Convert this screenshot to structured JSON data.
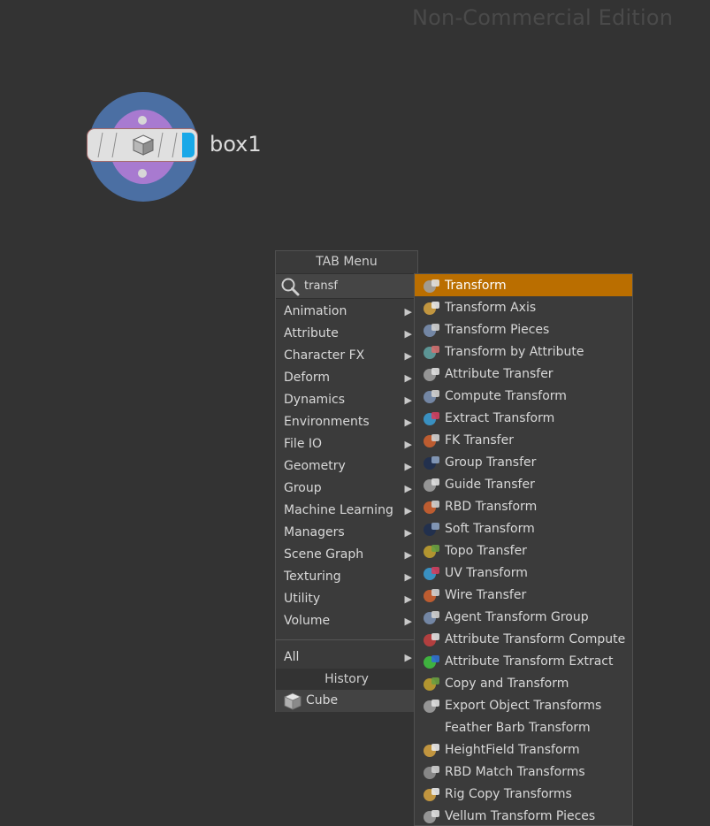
{
  "watermark": "Non-Commercial Edition",
  "node": {
    "label": "box1"
  },
  "tab_menu": {
    "title": "TAB Menu",
    "search": {
      "value": "transf"
    },
    "categories": [
      {
        "label": "Animation"
      },
      {
        "label": "Attribute"
      },
      {
        "label": "Character FX"
      },
      {
        "label": "Deform"
      },
      {
        "label": "Dynamics"
      },
      {
        "label": "Environments"
      },
      {
        "label": "File IO"
      },
      {
        "label": "Geometry"
      },
      {
        "label": "Group"
      },
      {
        "label": "Machine Learning"
      },
      {
        "label": "Managers"
      },
      {
        "label": "Scene Graph"
      },
      {
        "label": "Texturing"
      },
      {
        "label": "Utility"
      },
      {
        "label": "Volume"
      }
    ],
    "all_label": "All",
    "history_title": "History",
    "history_items": [
      {
        "label": "Cube",
        "icon": "cube-icon"
      }
    ]
  },
  "results": [
    {
      "label": "Transform",
      "icon": "transform-icon",
      "active": true,
      "color": "#ba6e00"
    },
    {
      "label": "Transform Axis",
      "icon": "transform-axis-icon"
    },
    {
      "label": "Transform Pieces",
      "icon": "transform-pieces-icon"
    },
    {
      "label": "Transform by Attribute",
      "icon": "transform-by-attribute-icon"
    },
    {
      "label": "Attribute Transfer",
      "icon": "attribute-transfer-icon"
    },
    {
      "label": "Compute Transform",
      "icon": "compute-transform-icon"
    },
    {
      "label": "Extract Transform",
      "icon": "extract-transform-icon"
    },
    {
      "label": "FK Transfer",
      "icon": "fk-transfer-icon"
    },
    {
      "label": "Group Transfer",
      "icon": "group-transfer-icon"
    },
    {
      "label": "Guide Transfer",
      "icon": "guide-transfer-icon"
    },
    {
      "label": "RBD Transform",
      "icon": "rbd-transform-icon"
    },
    {
      "label": "Soft Transform",
      "icon": "soft-transform-icon"
    },
    {
      "label": "Topo Transfer",
      "icon": "topo-transfer-icon"
    },
    {
      "label": "UV Transform",
      "icon": "uv-transform-icon"
    },
    {
      "label": "Wire Transfer",
      "icon": "wire-transfer-icon"
    },
    {
      "label": "Agent Transform Group",
      "icon": "agent-transform-group-icon"
    },
    {
      "label": "Attribute Transform Compute",
      "icon": "attribute-transform-compute-icon"
    },
    {
      "label": "Attribute Transform Extract",
      "icon": "attribute-transform-extract-icon"
    },
    {
      "label": "Copy and Transform",
      "icon": "copy-and-transform-icon"
    },
    {
      "label": "Export Object Transforms",
      "icon": "export-object-transforms-icon"
    },
    {
      "label": "Feather Barb Transform",
      "icon": ""
    },
    {
      "label": "HeightField Transform",
      "icon": "heightfield-transform-icon"
    },
    {
      "label": "RBD Match Transforms",
      "icon": "rbd-match-transforms-icon"
    },
    {
      "label": "Rig Copy Transforms",
      "icon": "rig-copy-transforms-icon"
    },
    {
      "label": "Vellum Transform Pieces",
      "icon": "vellum-transform-pieces-icon"
    }
  ]
}
